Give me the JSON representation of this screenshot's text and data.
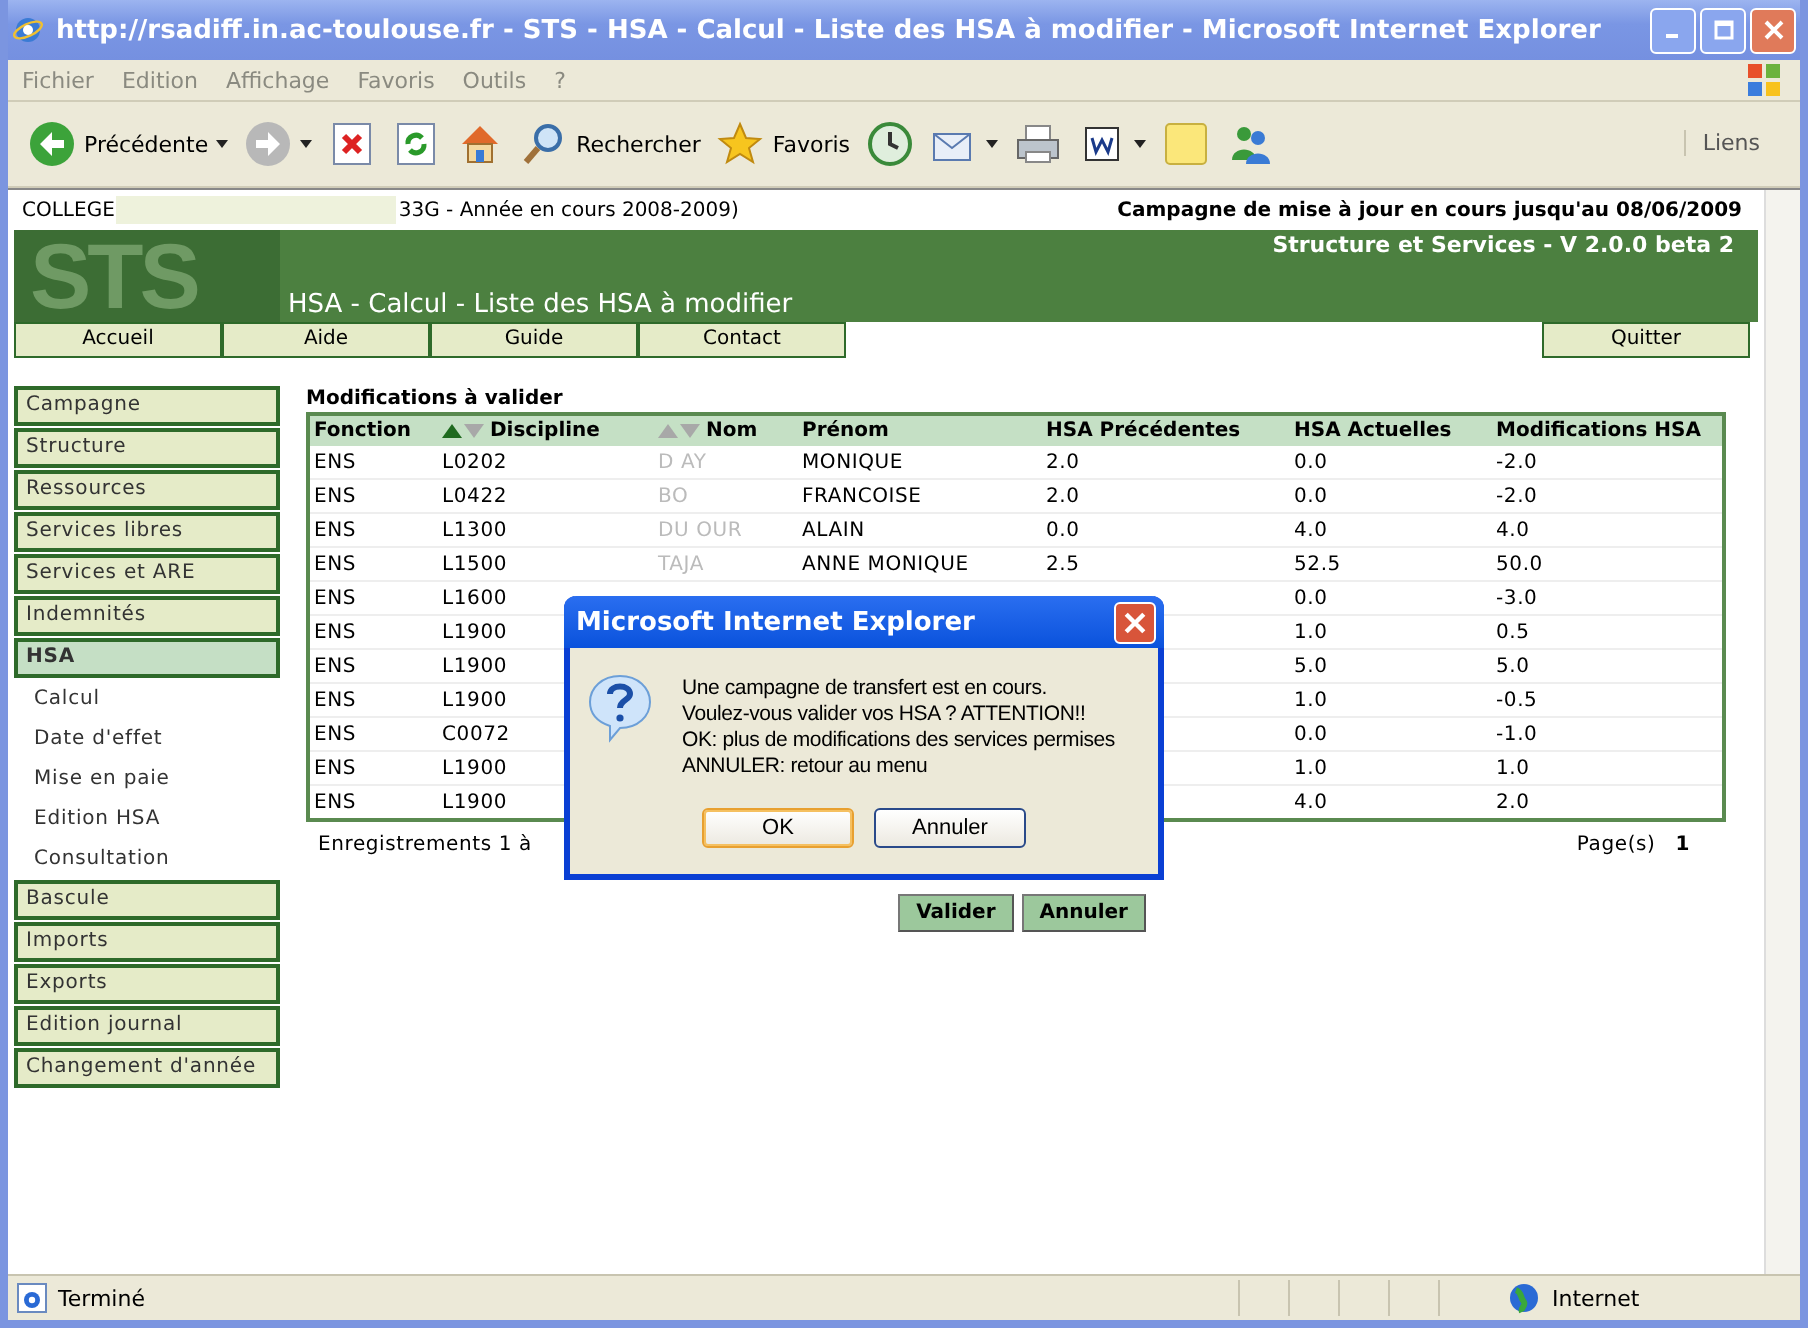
{
  "window": {
    "title": "http://rsadiff.in.ac-toulouse.fr - STS - HSA - Calcul - Liste des HSA à modifier - Microsoft Internet Explorer"
  },
  "menu": [
    "Fichier",
    "Edition",
    "Affichage",
    "Favoris",
    "Outils",
    "?"
  ],
  "toolbar": [
    {
      "kind": "back",
      "label": "Précédente",
      "dropdown": true
    },
    {
      "kind": "forward",
      "dropdown": true
    },
    {
      "kind": "stop"
    },
    {
      "kind": "refresh"
    },
    {
      "kind": "home"
    },
    {
      "kind": "search",
      "label": "Rechercher"
    },
    {
      "kind": "favorites",
      "label": "Favoris"
    },
    {
      "kind": "history"
    },
    {
      "kind": "mail",
      "dropdown": true
    },
    {
      "kind": "print"
    },
    {
      "kind": "edit",
      "dropdown": true
    },
    {
      "kind": "note"
    },
    {
      "kind": "messenger"
    }
  ],
  "links_label": "Liens",
  "header": {
    "college": "COLLEGE",
    "college_rest": "33G - Année en cours 2008-2009)",
    "campaign": "Campagne de mise à jour en cours jusqu'au 08/06/2009",
    "logo": "STS",
    "app_name": "Structure et Services - V 2.0.0 beta 2",
    "page_title": "HSA - Calcul - Liste des HSA à modifier"
  },
  "nav": [
    "Accueil",
    "Aide",
    "Guide",
    "Contact"
  ],
  "quit": "Quitter",
  "sidebar": [
    {
      "label": "Campagne",
      "selected": false
    },
    {
      "label": "Structure",
      "selected": false
    },
    {
      "label": "Ressources",
      "selected": false
    },
    {
      "label": "Services libres",
      "selected": false
    },
    {
      "label": "Services et ARE",
      "selected": false
    },
    {
      "label": "Indemnités",
      "selected": false
    },
    {
      "label": "HSA",
      "selected": true,
      "children": [
        "Calcul",
        "Date d'effet",
        "Mise en paie",
        "Edition HSA",
        "Consultation"
      ]
    },
    {
      "label": "Bascule",
      "selected": false
    },
    {
      "label": "Imports",
      "selected": false
    },
    {
      "label": "Exports",
      "selected": false
    },
    {
      "label": "Edition journal",
      "selected": false
    },
    {
      "label": "Changement d'année",
      "selected": false
    }
  ],
  "table": {
    "title": "Modifications à valider",
    "columns": [
      {
        "label": "Fonction"
      },
      {
        "label": "Discipline",
        "sorted_ascending": true
      },
      {
        "label": "Nom",
        "sorted_ascending": false
      },
      {
        "label": "Prénom"
      },
      {
        "label": "HSA Précédentes"
      },
      {
        "label": "HSA Actuelles"
      },
      {
        "label": "Modifications HSA"
      }
    ],
    "rows": [
      [
        "ENS",
        "L0202",
        "D   AY",
        "MONIQUE",
        "2.0",
        "0.0",
        "-2.0"
      ],
      [
        "ENS",
        "L0422",
        "BO",
        "FRANCOISE",
        "2.0",
        "0.0",
        "-2.0"
      ],
      [
        "ENS",
        "L1300",
        "DU OUR",
        "ALAIN",
        "0.0",
        "4.0",
        "4.0"
      ],
      [
        "ENS",
        "L1500",
        "TAJA",
        "ANNE MONIQUE",
        "2.5",
        "52.5",
        "50.0"
      ],
      [
        "ENS",
        "L1600",
        null,
        null,
        null,
        "0.0",
        "-3.0"
      ],
      [
        "ENS",
        "L1900",
        null,
        null,
        null,
        "1.0",
        "0.5"
      ],
      [
        "ENS",
        "L1900",
        null,
        null,
        null,
        "5.0",
        "5.0"
      ],
      [
        "ENS",
        "L1900",
        null,
        null,
        null,
        "1.0",
        "-0.5"
      ],
      [
        "ENS",
        "C0072",
        null,
        null,
        null,
        "0.0",
        "-1.0"
      ],
      [
        "ENS",
        "L1900",
        null,
        null,
        null,
        "1.0",
        "1.0"
      ],
      [
        "ENS",
        "L1900",
        null,
        null,
        null,
        "4.0",
        "2.0"
      ]
    ],
    "records": "Enregistrements 1 à",
    "pages_label": "Page(s)",
    "page": "1"
  },
  "actions": [
    "Valider",
    "Annuler"
  ],
  "dialog": {
    "title": "Microsoft Internet Explorer",
    "lines": [
      "Une campagne de transfert est en cours.",
      "Voulez-vous valider vos HSA ? ATTENTION!!",
      "OK: plus de modifications des services permises",
      "ANNULER: retour au menu"
    ],
    "buttons": [
      {
        "label": "OK",
        "default": true
      },
      {
        "label": "Annuler",
        "default": false
      }
    ]
  },
  "status": {
    "text": "Terminé",
    "zone": "Internet"
  }
}
